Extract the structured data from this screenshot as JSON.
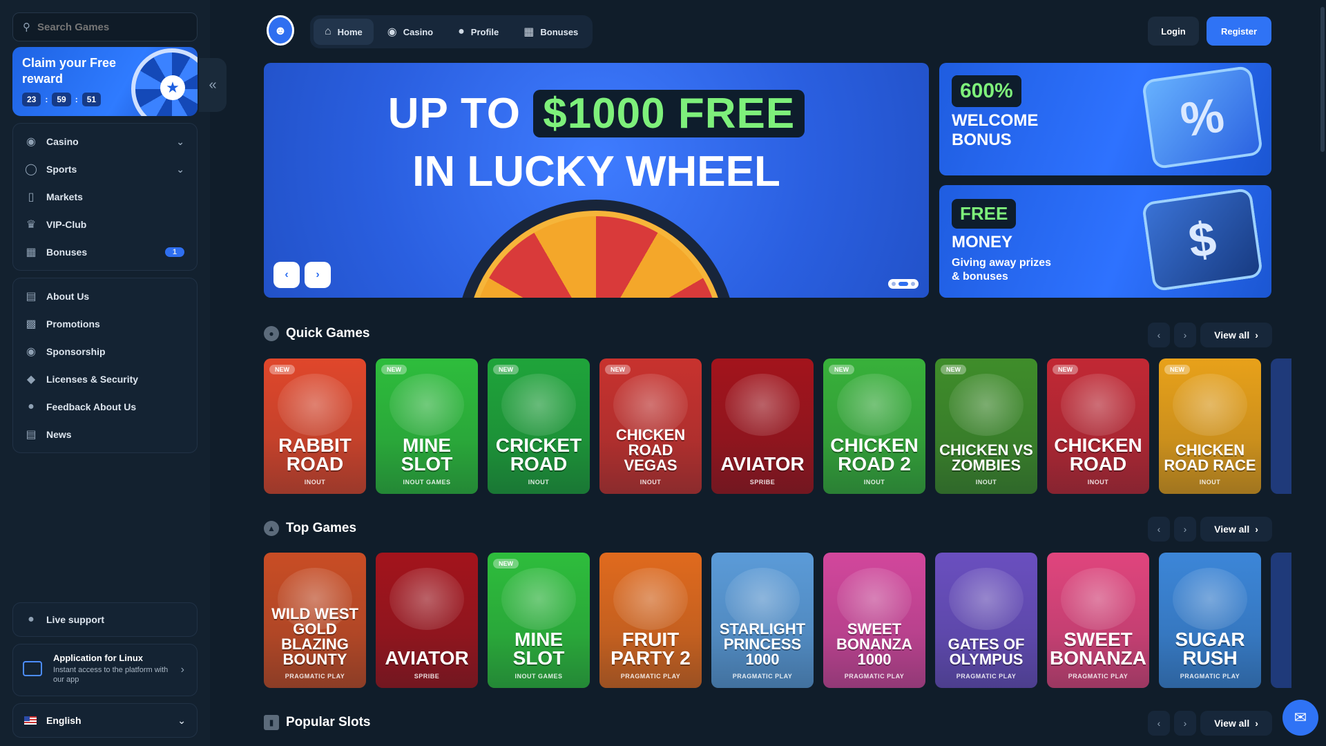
{
  "sidebar": {
    "search_placeholder": "Search Games",
    "claim": {
      "title": "Claim your Free reward",
      "timer": [
        "23",
        "59",
        "51"
      ]
    },
    "nav_main": [
      {
        "label": "Casino",
        "icon": "casino-chip-icon",
        "chevron": true
      },
      {
        "label": "Sports",
        "icon": "globe-icon",
        "chevron": true
      },
      {
        "label": "Markets",
        "icon": "markets-chart-icon"
      },
      {
        "label": "VIP-Club",
        "icon": "crown-icon"
      },
      {
        "label": "Bonuses",
        "icon": "gift-icon",
        "badge": "1"
      }
    ],
    "nav_info": [
      {
        "label": "About Us",
        "icon": "book-icon"
      },
      {
        "label": "Promotions",
        "icon": "promotions-icon"
      },
      {
        "label": "Sponsorship",
        "icon": "medal-icon"
      },
      {
        "label": "Licenses & Security",
        "icon": "shield-icon"
      },
      {
        "label": "Feedback About Us",
        "icon": "chat-bubble-icon"
      },
      {
        "label": "News",
        "icon": "newspaper-icon"
      }
    ],
    "live_support": "Live support",
    "app": {
      "title": "Application for Linux",
      "desc": "Instant access to the platform with our app"
    },
    "language": "English"
  },
  "header": {
    "tabs": [
      "Home",
      "Casino",
      "Profile",
      "Bonuses"
    ],
    "active_tab": "Home",
    "login": "Login",
    "register": "Register"
  },
  "hero": {
    "line1_prefix": "UP TO",
    "line1_highlight": "$1000 FREE",
    "line2": "IN LUCKY WHEEL",
    "slides": 3,
    "active_slide": 2
  },
  "promos": [
    {
      "tag": "600%",
      "title": "WELCOME BONUS",
      "desc": ""
    },
    {
      "tag": "FREE",
      "title": "MONEY",
      "desc": "Giving away prizes & bonuses"
    }
  ],
  "sections": {
    "quick": {
      "title": "Quick Games",
      "view_all": "View all",
      "games": [
        {
          "name": "RABBIT ROAD",
          "provider": "INOUT",
          "new": true,
          "color": "#e0472b"
        },
        {
          "name": "MINE SLOT",
          "provider": "INOUT GAMES",
          "new": true,
          "color": "#2ebd3c"
        },
        {
          "name": "CRICKET ROAD",
          "provider": "INOUT",
          "new": true,
          "color": "#1fa43a"
        },
        {
          "name": "CHICKEN ROAD VEGAS",
          "provider": "INOUT",
          "new": true,
          "color": "#c8322e"
        },
        {
          "name": "AVIATOR",
          "provider": "SPRIBE",
          "new": false,
          "color": "#a3141c"
        },
        {
          "name": "CHICKEN ROAD 2",
          "provider": "INOUT",
          "new": true,
          "color": "#38b13a"
        },
        {
          "name": "CHICKEN VS ZOMBIES",
          "provider": "INOUT",
          "new": true,
          "color": "#3f8d2a"
        },
        {
          "name": "CHICKEN ROAD",
          "provider": "INOUT",
          "new": true,
          "color": "#c22834"
        },
        {
          "name": "CHICKEN ROAD RACE",
          "provider": "INOUT",
          "new": true,
          "color": "#e8a11a"
        }
      ]
    },
    "top": {
      "title": "Top Games",
      "view_all": "View all",
      "games": [
        {
          "name": "WILD WEST GOLD BLAZING BOUNTY",
          "provider": "PRAGMATIC PLAY",
          "new": false,
          "color": "#c94d25"
        },
        {
          "name": "AVIATOR",
          "provider": "SPRIBE",
          "new": false,
          "color": "#a3141c"
        },
        {
          "name": "MINE SLOT",
          "provider": "INOUT GAMES",
          "new": true,
          "color": "#2ebd3c"
        },
        {
          "name": "FRUIT PARTY 2",
          "provider": "PRAGMATIC PLAY",
          "new": false,
          "color": "#e06a1e"
        },
        {
          "name": "STARLIGHT PRINCESS 1000",
          "provider": "PRAGMATIC PLAY",
          "new": false,
          "color": "#5b9bd8"
        },
        {
          "name": "SWEET BONANZA 1000",
          "provider": "PRAGMATIC PLAY",
          "new": false,
          "color": "#d2479c"
        },
        {
          "name": "GATES OF OLYMPUS",
          "provider": "PRAGMATIC PLAY",
          "new": false,
          "color": "#6a4fbf"
        },
        {
          "name": "SWEET BONANZA",
          "provider": "PRAGMATIC PLAY",
          "new": false,
          "color": "#e0457d"
        },
        {
          "name": "SUGAR RUSH",
          "provider": "PRAGMATIC PLAY",
          "new": false,
          "color": "#3c86d8"
        }
      ]
    },
    "popular": {
      "title": "Popular Slots",
      "view_all": "View all"
    }
  }
}
